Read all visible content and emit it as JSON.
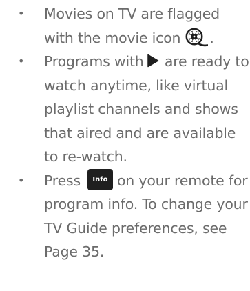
{
  "bullets": [
    {
      "text_before": "Movies on TV are flagged with the movie icon",
      "text_after": ".",
      "icon": "movie-reel-icon"
    },
    {
      "text_before": "Programs with",
      "text_after": "are ready to watch anytime, like virtual playlist channels and shows that aired and are available to re-watch.",
      "icon": "play-triangle-icon"
    },
    {
      "text_before": "Press",
      "button_label": "Info",
      "text_after": "on your remote for program info. To change your TV Guide preferences, see Page 35."
    }
  ],
  "bullet_char": "•",
  "colors": {
    "text": "#6b6b6b",
    "icon": "#1f1f1f",
    "button_bg": "#1f1f1f",
    "button_text": "#ffffff"
  }
}
